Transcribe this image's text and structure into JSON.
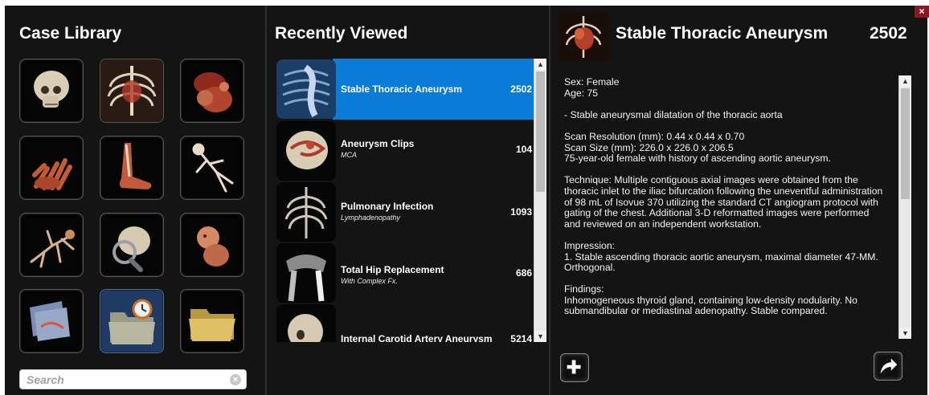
{
  "window": {
    "close_label": "×"
  },
  "case_library": {
    "title": "Case Library",
    "tiles": [
      {
        "icon": "skull-icon"
      },
      {
        "icon": "ribcage-icon"
      },
      {
        "icon": "abdomen-icon"
      },
      {
        "icon": "hand-icon"
      },
      {
        "icon": "foot-icon"
      },
      {
        "icon": "skeleton-icon"
      },
      {
        "icon": "fetal-skeleton-icon"
      },
      {
        "icon": "skull-magnifier-icon"
      },
      {
        "icon": "fetus-icon"
      },
      {
        "icon": "scan-images-icon"
      },
      {
        "icon": "recent-folder-icon"
      },
      {
        "icon": "folder-icon"
      }
    ],
    "search": {
      "placeholder": "Search",
      "value": ""
    }
  },
  "recently_viewed": {
    "title": "Recently Viewed",
    "items": [
      {
        "name": "Stable Thoracic Aneurysm",
        "subtitle": "",
        "number": "2502",
        "icon": "thoracic-aorta-icon",
        "active": true
      },
      {
        "name": "Aneurysm Clips",
        "subtitle": "MCA",
        "number": "104",
        "icon": "skull-vessels-icon",
        "active": false
      },
      {
        "name": "Pulmonary Infection",
        "subtitle": "Lymphadenopathy",
        "number": "1093",
        "icon": "chest-icon",
        "active": false
      },
      {
        "name": "Total Hip Replacement",
        "subtitle": "With Complex Fx.",
        "number": "686",
        "icon": "hip-icon",
        "active": false
      },
      {
        "name": "Internal Carotid Artery Aneurysm",
        "subtitle": "",
        "number": "5214",
        "icon": "skull-icon",
        "active": false
      }
    ]
  },
  "details": {
    "title": "Stable Thoracic Aneurysm",
    "number": "2502",
    "icon": "thoracic-aorta-icon",
    "paragraphs": [
      "Sex: Female\nAge: 75",
      "- Stable aneurysmal dilatation of the thoracic aorta",
      "Scan Resolution (mm): 0.44 x 0.44 x 0.70\nScan Size (mm): 226.0 x 226.0 x 206.5\n75-year-old female with history of ascending aortic aneurysm.",
      "Technique: Multiple contiguous axial images were obtained from the\nthoracic inlet to the iliac bifurcation following the uneventful administration\nof 98 mL of Isovue 370 utilizing the standard CT angiogram protocol with\ngating of the chest. Additional 3-D reformatted images were performed\nand reviewed on an independent workstation.",
      "Impression:\n1. Stable ascending thoracic aortic aneurysm, maximal diameter 47-MM.\nOrthogonal.",
      "Findings:\nInhomogeneous thyroid gland, containing low-density nodularity. No\nsubmandibular or mediastinal adenopathy. Stable compared."
    ],
    "add_icon": "plus-icon",
    "share_icon": "share-arrow-icon"
  }
}
